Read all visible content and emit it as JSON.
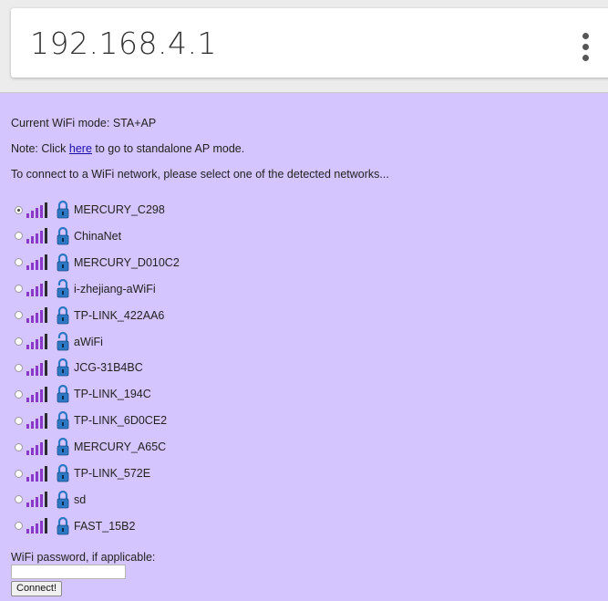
{
  "browser": {
    "url": "192.168.4.1",
    "menu_icon": "more-vertical-icon"
  },
  "page": {
    "mode_line": "Current WiFi mode: STA+AP",
    "note_prefix": "Note: Click ",
    "note_link": "here",
    "note_suffix": " to go to standalone AP mode.",
    "instruction": "To connect to a WiFi network, please select one of the detected networks...",
    "password_label": "WiFi password, if applicable:",
    "password_value": "",
    "connect_label": "Connect!"
  },
  "colors": {
    "page_background": "#d5c5ff",
    "signal": "#8a38c8",
    "signal_full_bar": "#2b2b2b",
    "lock": "#2c78c4",
    "link": "#1a0dab"
  },
  "networks": [
    {
      "ssid": "MERCURY_C298",
      "selected": true,
      "locked": true,
      "signal_icon": "wifi-signal-icon",
      "lock_icon": "lock-closed-icon"
    },
    {
      "ssid": "ChinaNet",
      "selected": false,
      "locked": true,
      "signal_icon": "wifi-signal-icon",
      "lock_icon": "lock-closed-icon"
    },
    {
      "ssid": "MERCURY_D010C2",
      "selected": false,
      "locked": true,
      "signal_icon": "wifi-signal-icon",
      "lock_icon": "lock-closed-icon"
    },
    {
      "ssid": "i-zhejiang-aWiFi",
      "selected": false,
      "locked": false,
      "signal_icon": "wifi-signal-icon",
      "lock_icon": "lock-open-icon"
    },
    {
      "ssid": "TP-LINK_422AA6",
      "selected": false,
      "locked": true,
      "signal_icon": "wifi-signal-icon",
      "lock_icon": "lock-closed-icon"
    },
    {
      "ssid": "aWiFi",
      "selected": false,
      "locked": false,
      "signal_icon": "wifi-signal-icon",
      "lock_icon": "lock-open-icon"
    },
    {
      "ssid": "JCG-31B4BC",
      "selected": false,
      "locked": true,
      "signal_icon": "wifi-signal-icon",
      "lock_icon": "lock-closed-icon"
    },
    {
      "ssid": "TP-LINK_194C",
      "selected": false,
      "locked": true,
      "signal_icon": "wifi-signal-icon",
      "lock_icon": "lock-closed-icon"
    },
    {
      "ssid": "TP-LINK_6D0CE2",
      "selected": false,
      "locked": true,
      "signal_icon": "wifi-signal-icon",
      "lock_icon": "lock-closed-icon"
    },
    {
      "ssid": "MERCURY_A65C",
      "selected": false,
      "locked": true,
      "signal_icon": "wifi-signal-icon",
      "lock_icon": "lock-closed-icon"
    },
    {
      "ssid": "TP-LINK_572E",
      "selected": false,
      "locked": true,
      "signal_icon": "wifi-signal-icon",
      "lock_icon": "lock-closed-icon"
    },
    {
      "ssid": "sd",
      "selected": false,
      "locked": true,
      "signal_icon": "wifi-signal-icon",
      "lock_icon": "lock-closed-icon"
    },
    {
      "ssid": "FAST_15B2",
      "selected": false,
      "locked": true,
      "signal_icon": "wifi-signal-icon",
      "lock_icon": "lock-closed-icon"
    }
  ]
}
